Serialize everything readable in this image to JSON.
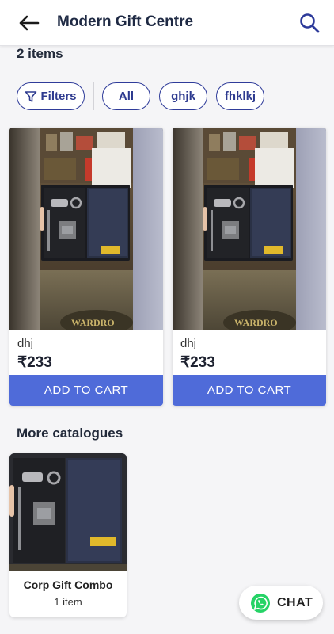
{
  "header": {
    "title": "Modern Gift Centre",
    "back_icon": "arrow-left-icon",
    "search_icon": "search-icon"
  },
  "listing": {
    "item_count": "2 items"
  },
  "filters": {
    "filters_label": "Filters",
    "chips": [
      "All",
      "ghjk",
      "fhklkj"
    ]
  },
  "products": [
    {
      "name": "dhj",
      "price": "₹233",
      "cta": "ADD TO CART"
    },
    {
      "name": "dhj",
      "price": "₹233",
      "cta": "ADD TO CART"
    }
  ],
  "more_catalogues": {
    "title": "More catalogues",
    "items": [
      {
        "name": "Corp Gift Combo",
        "count": "1 item"
      }
    ]
  },
  "chat": {
    "label": "CHAT"
  },
  "colors": {
    "primary": "#4f6bd9",
    "chip_border": "#2f3c9a",
    "whatsapp": "#25d366"
  }
}
